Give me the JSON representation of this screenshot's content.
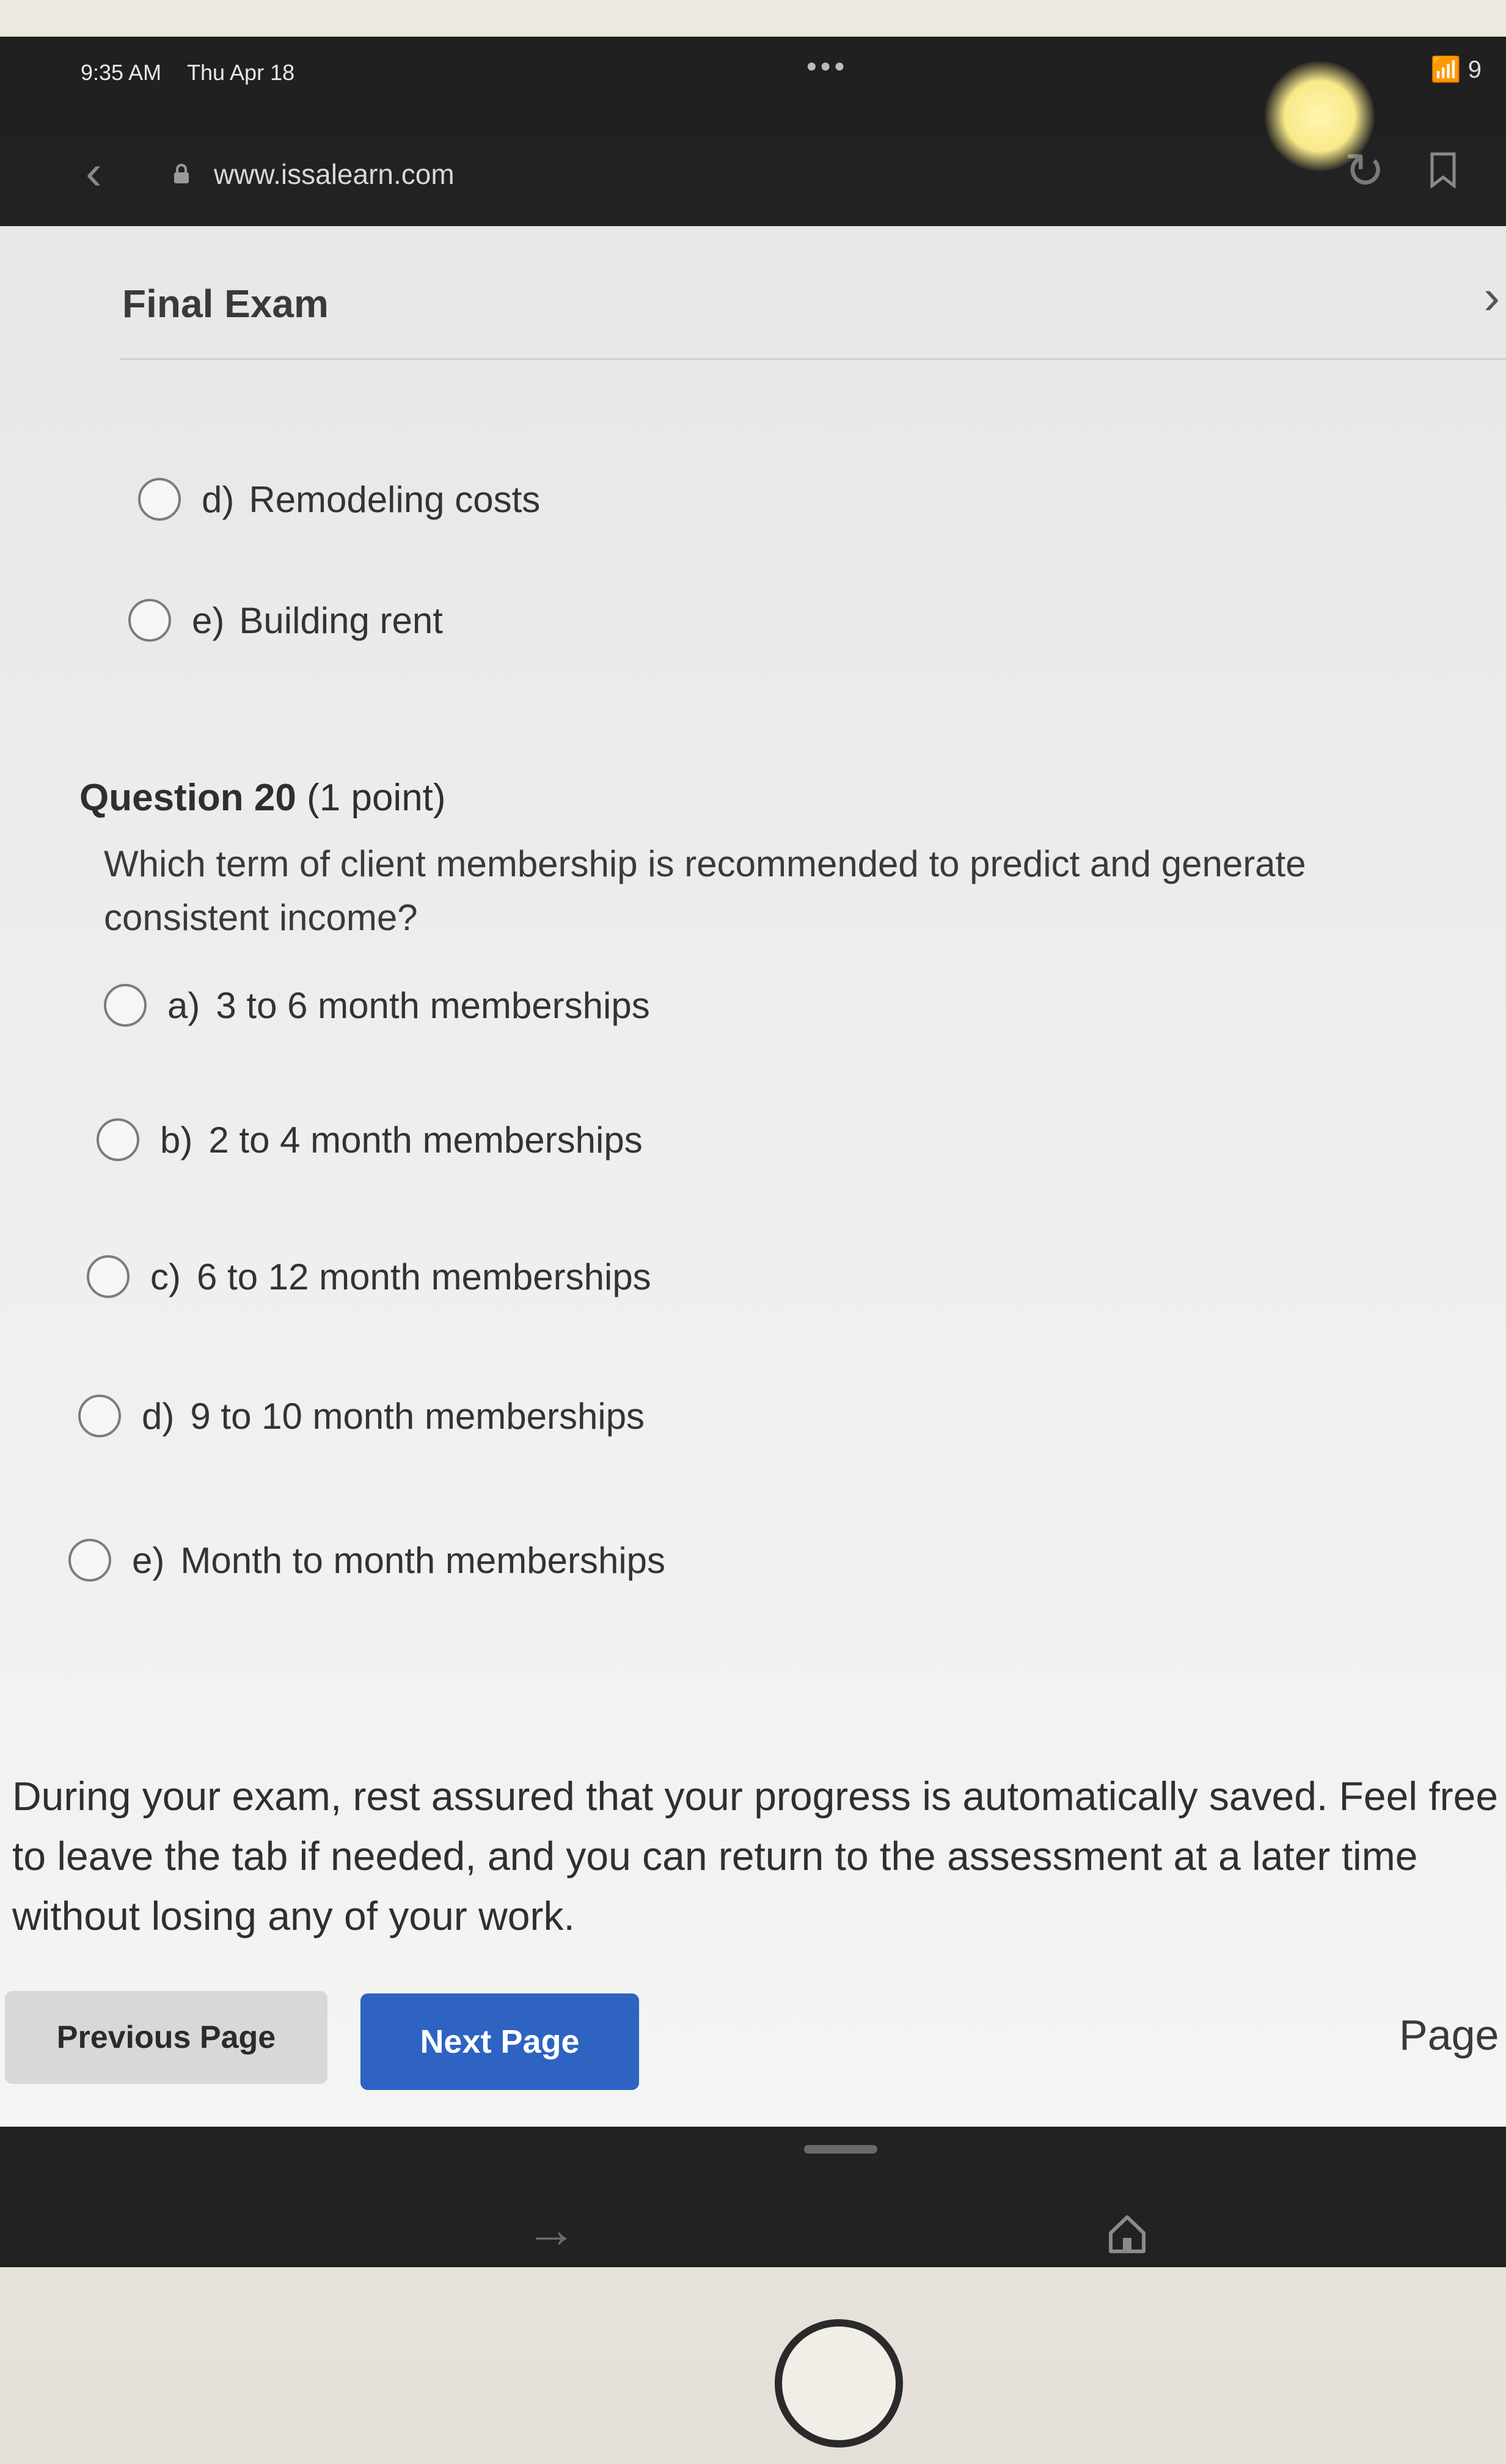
{
  "status_bar": {
    "time": "9:35 AM",
    "date": "Thu Apr 18",
    "dots": "•••",
    "wifi": "9"
  },
  "browser": {
    "url": "www.issalearn.com",
    "back_glyph": "‹",
    "reload_glyph": "↻",
    "icons": [
      "back-icon",
      "lock-icon",
      "reload-icon",
      "bookmark-icon"
    ]
  },
  "exam": {
    "title": "Final Exam",
    "close_glyph": "›"
  },
  "previous_question": {
    "options": [
      {
        "letter": "d)",
        "text": "Remodeling costs"
      },
      {
        "letter": "e)",
        "text": "Building rent"
      }
    ]
  },
  "question": {
    "number_label": "Question 20",
    "points": "(1 point)",
    "text": "Which term of client membership is recommended to predict and generate consistent income?",
    "options": [
      {
        "letter": "a)",
        "text": "3 to 6 month memberships"
      },
      {
        "letter": "b)",
        "text": "2 to 4 month memberships"
      },
      {
        "letter": "c)",
        "text": "6 to 12 month memberships"
      },
      {
        "letter": "d)",
        "text": "9 to 10 month memberships"
      },
      {
        "letter": "e)",
        "text": "Month to month memberships"
      }
    ]
  },
  "notice": "During your exam, rest assured that your progress is automatically saved. Feel free to leave the tab if needed, and you can return to the assessment at a later time without losing any of your work.",
  "navigation": {
    "previous_label": "Previous Page",
    "next_label": "Next Page",
    "page_label": "Page"
  },
  "toolbar": {
    "forward_glyph": "→"
  },
  "colors": {
    "next_button": "#2e63c2",
    "previous_button": "#d8d8d8",
    "browser_chrome": "#222222"
  }
}
